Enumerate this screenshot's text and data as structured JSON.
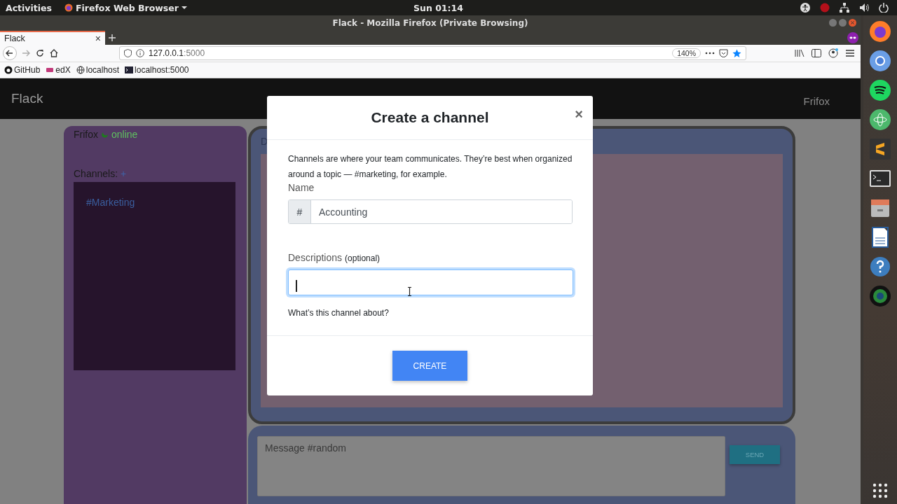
{
  "top_bar": {
    "activities": "Activities",
    "app_menu": "Firefox Web Browser",
    "clock": "Sun 01:14"
  },
  "window": {
    "title": "Flack - Mozilla Firefox (Private Browsing)"
  },
  "tabs": [
    {
      "label": "Flack",
      "close": "×",
      "selected": true
    }
  ],
  "address_bar": {
    "host": "127.0.0.1",
    "port": ":5000",
    "zoom": "140%"
  },
  "bookmarks": [
    {
      "label": "GitHub"
    },
    {
      "label": "edX"
    },
    {
      "label": "localhost"
    },
    {
      "label": "localhost:5000"
    }
  ],
  "page": {
    "brand": "Flack",
    "user_menu": "Frifox",
    "sidebar": {
      "user": "Frifox",
      "status": "online",
      "channels_label": "Channels:",
      "add": "+",
      "channels": [
        {
          "name": "#Marketing"
        }
      ]
    },
    "chat_header": "D",
    "composer": {
      "placeholder": "Message #random",
      "send": "SEND"
    }
  },
  "modal": {
    "title": "Create a channel",
    "close": "×",
    "intro": "Channels are where your team communicates. They’re best when organized around a topic — #marketing, for example.",
    "name_label": "Name",
    "name_prefix": "#",
    "name_value": "Accounting",
    "description_label": "Descriptions",
    "description_hint": "(optional)",
    "description_focused": true,
    "help": "What’s this channel about?",
    "submit": "CREATE"
  }
}
